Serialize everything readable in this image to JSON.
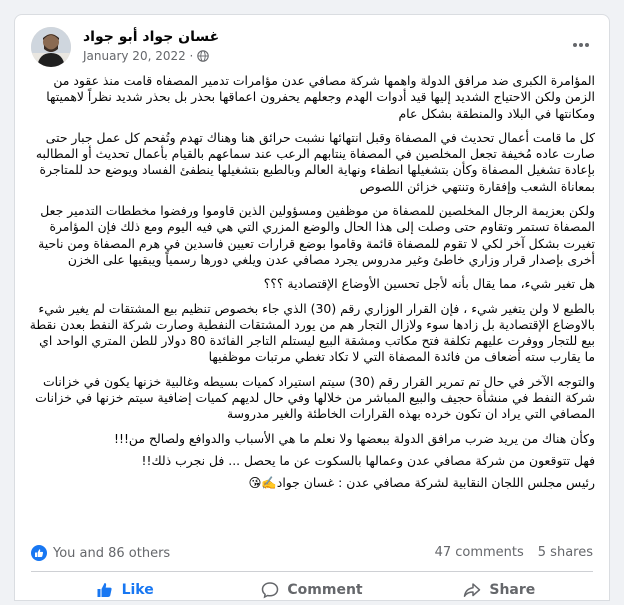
{
  "post": {
    "author": "غسان جواد أبو جواد",
    "date": "January 20, 2022 ·",
    "paragraphs": [
      "المؤامرة الكبرى ضد مرافق الدولة واهمها شركة مصافي عدن مؤامرات تدمير المصفاه قامت منذ عقود من الزمن ولكن الاحتياج الشديد إليها قيد أدوات الهدم وجعلهم يحفرون اعماقها بحذر بل بحذر شديد نظراً لاهميتها ومكانتها في البلاد والمنطقة بشكل عام",
      "كل ما قامت أعمال تحديث في المصفاة وقبل انتهائها نشبت حرائق هنا وهناك تهدم وتُفحم كل عمل جبار حتى صارت عاده مُخيفة تجعل المخلصين في المصفاة ينتابهم الرعب عند سماعهم بالقيام بأعمال تحديث أو المطالبه بإعادة تشغيل المصفاة وكأن بتشغيلها انطفاء ونهاية العالم وبالطبع بتشغيلها ينطفئ الفساد ويوضع حد للمتاجرة بمعاناة الشعب وإفقارة وتنتهي خزائن اللصوص",
      "ولكن بعزيمة الرجال المخلصين للمصفاة من موظفين ومسؤولين الذين قاوموا ورفضوا مخططات التدمير جعل المصفاة تستمر وتقاوم حتى وصلت إلى هذا الحال والوضع المزري التي هي فيه اليوم ومع ذلك فإن المؤامرة تغيرت بشكل آخر لكي لا تقوم للمصفاة قائمة وقاموا بوضع قرارات تعيين فاسدين في هرم المصفاة ومن ناحية أخرى بإصدار قرار وزاري خاطئ وغير مدروس يجرد مصافي عدن ويلغي دورها رسمياً ويبقيها على الخزن",
      "هل تغير شيء، مما يقال بأنه لأجل تحسين الأوضاع الإقتصادية ؟؟؟",
      "بالطبع لا ولن يتغير شيء ، فإن القرار الوزاري رقم (30) الذي جاء بخصوص تنظيم بيع المشتقات لم يغير شيء بالاوضاع الإقتصادية بل زادها سوء ولازال التجار هم من يورد المشتقات النفطية وصارت شركة النفط بعدن نقطة بيع للتجار ووفرت عليهم تكلفة فتح مكاتب ومشقة البيع ليستلم التاجر الفائدة 80 دولار للطن المتري الواحد اي ما يقارب سته أضعاف من فائدة المصفاة التي لا تكاد تغطي مرتبات موظفيها",
      "والتوجه الآخر في حال تم تمرير القرار رقم (30) سيتم استيراد كميات بسيطه وغالبية خزنها يكون في خزانات شركة النفط في منشأة حجيف والبيع المباشر من خلالها وفي حال لديهم كميات إضافية سيتم خزنها في خزانات المصافي التي يراد ان تكون خرده بهذه القرارات الخاطئة والغير مدروسة",
      "وكأن هناك من يريد ضرب مرافق الدولة ببعضها ولا نعلم ما هي الأسباب والدوافع ولصالح من!!!",
      "فهل تتوقعون من شركة مصافي عدن وعمالها بالسكوت عن ما يحصل ... فل نجرب ذلك!!",
      "رئيس مجلس اللجان النقابية لشركة مصافي عدن : غسان جواد✍️😘"
    ]
  },
  "stats": {
    "reactions": "You and 86 others",
    "comments": "47 comments",
    "shares": "5 shares"
  },
  "actions": {
    "like": "Like",
    "comment": "Comment",
    "share": "Share"
  },
  "icons": [
    "avatar-photo",
    "globe-icon",
    "more-options-icon",
    "like-badge-icon",
    "like-icon",
    "comment-icon",
    "share-icon"
  ],
  "colors": {
    "accent": "#1877f2",
    "muted": "#65676b",
    "text": "#050505"
  }
}
